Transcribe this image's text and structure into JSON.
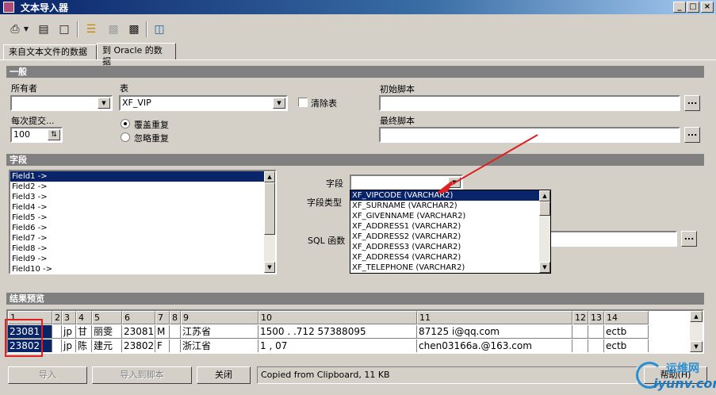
{
  "window": {
    "title": "文本导入器",
    "minimize": "_",
    "maximize": "□",
    "close": "×"
  },
  "toolbar": {
    "icons": [
      "print-icon",
      "dropdown-icon",
      "paste-icon",
      "new-icon",
      "open-folder-icon",
      "save-disabled-icon",
      "save-icon",
      "database-icon"
    ]
  },
  "tabs": [
    {
      "label": "来自文本文件的数据"
    },
    {
      "label": "到 Oracle 的数据"
    }
  ],
  "general": {
    "header": "一般",
    "owner_label": "所有者",
    "owner_value": "",
    "table_label": "表",
    "table_value": "XF_VIP",
    "clear_label": "清除表",
    "commit_label": "每次提交...",
    "commit_value": "100",
    "overwrite_label": "覆盖重复",
    "ignore_label": "忽略重复",
    "init_script_label": "初始脚本",
    "init_script_value": "",
    "final_script_label": "最终脚本",
    "final_script_value": "",
    "dots": "..."
  },
  "fields": {
    "header": "字段",
    "items": [
      "Field1 ->",
      "Field2 ->",
      "Field3 ->",
      "Field4 ->",
      "Field5 ->",
      "Field6 ->",
      "Field7 ->",
      "Field8 ->",
      "Field9 ->",
      "Field10 ->"
    ],
    "field_label": "字段",
    "field_value": "",
    "field_type_label": "字段类型",
    "sql_func_label": "SQL 函数",
    "dropdown_options": [
      "XF_VIPCODE (VARCHAR2)",
      "XF_SURNAME (VARCHAR2)",
      "XF_GIVENNAME (VARCHAR2)",
      "XF_ADDRESS1 (VARCHAR2)",
      "XF_ADDRESS2 (VARCHAR2)",
      "XF_ADDRESS3 (VARCHAR2)",
      "XF_ADDRESS4 (VARCHAR2)",
      "XF_TELEPHONE (VARCHAR2)"
    ]
  },
  "preview": {
    "header": "结果预览",
    "columns": [
      "1",
      "2",
      "3",
      "4",
      "5",
      "6",
      "7",
      "8",
      "9",
      "10",
      "11",
      "12",
      "13",
      "14"
    ],
    "rows": [
      [
        "23081",
        "",
        "jp",
        "甘",
        "丽雯",
        "23081",
        "M",
        "",
        "江苏省",
        "1500      .    .712 57388095",
        "87125     i@qq.com",
        "",
        "",
        "ectb"
      ],
      [
        "23802",
        "",
        "jp",
        "陈",
        "建元",
        "23802",
        "F",
        "",
        "浙江省",
        "1           ,        07",
        "chen03166a.@163.com",
        "",
        "",
        "ectb"
      ]
    ]
  },
  "buttons": {
    "import": "导入",
    "import_script": "导入到脚本",
    "close": "关闭",
    "help": "帮助(H)"
  },
  "status": "Copied from Clipboard,  11 KB",
  "watermark": {
    "line1": "运维网",
    "line2": "iyunv.com"
  },
  "colors": {
    "highlight": "#0a246a",
    "annotation": "#e02020"
  }
}
